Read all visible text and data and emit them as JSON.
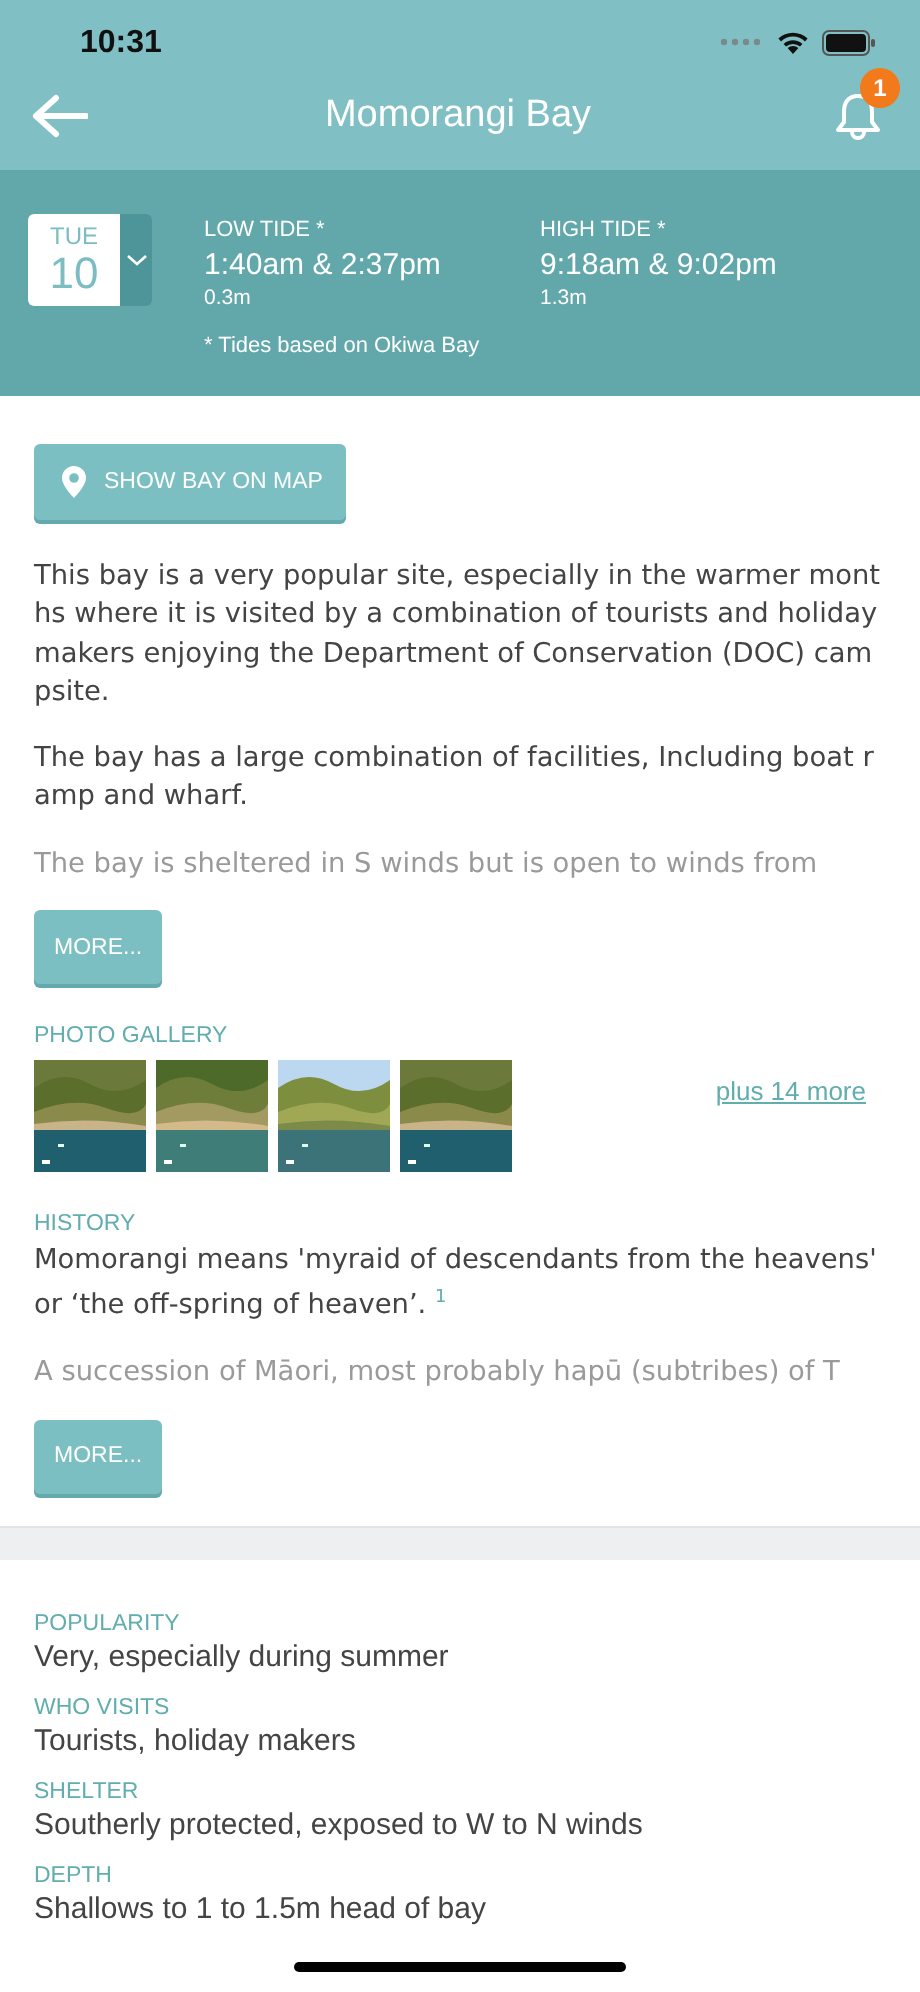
{
  "status_bar": {
    "time": "10:31"
  },
  "header": {
    "title": "Momorangi Bay",
    "notification_count": "1"
  },
  "date": {
    "weekday": "TUE",
    "day": "10"
  },
  "tides": [
    {
      "label": "LOW TIDE *",
      "times": "1:40am & 2:37pm",
      "height": "0.3m"
    },
    {
      "label": "HIGH TIDE *",
      "times": "9:18am & 9:02pm",
      "height": "1.3m"
    }
  ],
  "tide_note": "* Tides based on Okiwa Bay",
  "map_button": "SHOW BAY ON MAP",
  "description": {
    "paragraphs": [
      {
        "text": "This bay is a very popular site, especially in the warmer months where it is visited by a combination of tourists and holiday makers enjoying the Department of Conservation (DOC) campsite.",
        "faded": false
      },
      {
        "text": "The bay has a large combination of facilities, Including boat ramp and wharf.",
        "faded": false
      },
      {
        "text": "The bay is sheltered in S winds but is open to winds from",
        "faded": true
      }
    ],
    "more_button": "MORE..."
  },
  "gallery": {
    "heading": "PHOTO GALLERY",
    "more_link": "plus 14 more"
  },
  "history": {
    "heading": "HISTORY",
    "paragraphs": [
      {
        "text": "Momorangi means 'myraid of descendants from the heavens' or ‘the off-spring of heaven’. $^{1}$",
        "faded": false
      },
      {
        "text": "A succession of Māori, most probably hapū (subtribes) of T",
        "faded": true
      }
    ],
    "more_button": "MORE..."
  },
  "details": [
    {
      "label": "POPULARITY",
      "value": "Very, especially during summer"
    },
    {
      "label": "WHO VISITS",
      "value": "Tourists, holiday makers"
    },
    {
      "label": "SHELTER",
      "value": "Southerly protected, exposed to W to N winds"
    },
    {
      "label": "DEPTH",
      "value": "Shallows to 1 to 1.5m head of bay"
    }
  ]
}
